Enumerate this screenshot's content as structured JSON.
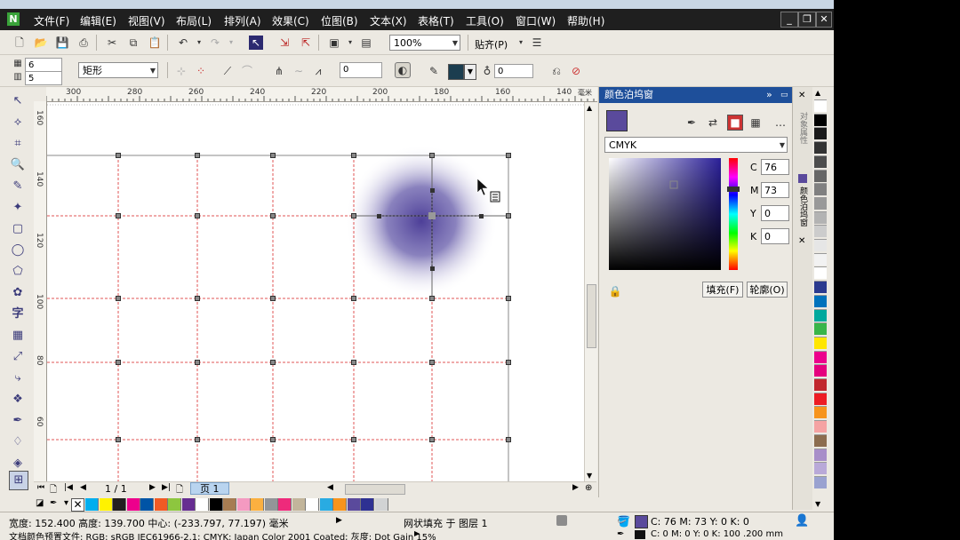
{
  "menu": [
    "文件(F)",
    "编辑(E)",
    "视图(V)",
    "布局(L)",
    "排列(A)",
    "效果(C)",
    "位图(B)",
    "文本(X)",
    "表格(T)",
    "工具(O)",
    "窗口(W)",
    "帮助(H)"
  ],
  "standard_toolbar": {
    "zoom": "100%",
    "snap": "贴齐(P)"
  },
  "property_bar": {
    "rows": "6",
    "cols": "5",
    "shape": "矩形",
    "smoothness": "0",
    "transparency": "0"
  },
  "ruler_h": [
    "300",
    "280",
    "260",
    "240",
    "220",
    "200",
    "180",
    "160",
    "140",
    "毫米"
  ],
  "ruler_v": [
    "160",
    "140",
    "120",
    "100",
    "80",
    "60"
  ],
  "page_nav": {
    "counter": "1 / 1",
    "tab": "页 1"
  },
  "docker": {
    "title": "颜色泊坞窗",
    "model": "CMYK",
    "channels": [
      {
        "label": "C",
        "value": "76"
      },
      {
        "label": "M",
        "value": "73"
      },
      {
        "label": "Y",
        "value": "0"
      },
      {
        "label": "K",
        "value": "0"
      }
    ],
    "fill_button": "填充(F)",
    "outline_button": "轮廓(O)",
    "current_color": "#5a4a9c",
    "side_tab_1": "对象属性",
    "side_tab_2": "颜色泊坞窗"
  },
  "palette_v": [
    "#ffffff",
    "#000000",
    "#1a1a1a",
    "#333333",
    "#4d4d4d",
    "#666666",
    "#808080",
    "#999999",
    "#b3b3b3",
    "#cccccc",
    "#e6e6e6",
    "#f2f2f2",
    "#ffffff",
    "#2b3a8f",
    "#0072bc",
    "#00a99d",
    "#39b54a",
    "#ffe600",
    "#ec008c",
    "#e5007e",
    "#c1272d",
    "#ed1c24",
    "#f7941d",
    "#f5a3a3",
    "#8c6d4f",
    "#a88ec9",
    "#b9a9d8",
    "#9aa2d0"
  ],
  "palette_h": [
    "#00aeef",
    "#fff200",
    "#231f20",
    "#ed008c",
    "#0054a6",
    "#f15a24",
    "#8dc63f",
    "#662d91",
    "#ffffff",
    "#000000",
    "#a67c52",
    "#f49ac1",
    "#fbb040",
    "#939598",
    "#ee2a7b",
    "#c2b59b",
    "#ffffff",
    "#29abe2",
    "#f7941d",
    "#5a4a9c",
    "#2e3192",
    "#d1d3d4"
  ],
  "status": {
    "dims": "宽度: 152.400 高度: 139.700 中心: (-233.797, 77.197) 毫米",
    "object": "网状填充 于 图层 1",
    "fill": "C: 76 M: 73 Y: 0 K: 0",
    "outline": "C: 0 M: 0 Y: 0 K: 100  .200 mm",
    "profile": "文档颜色预置文件: RGB: sRGB IEC61966-2.1; CMYK: Japan Color 2001 Coated; 灰度: Dot Gain 15%"
  }
}
